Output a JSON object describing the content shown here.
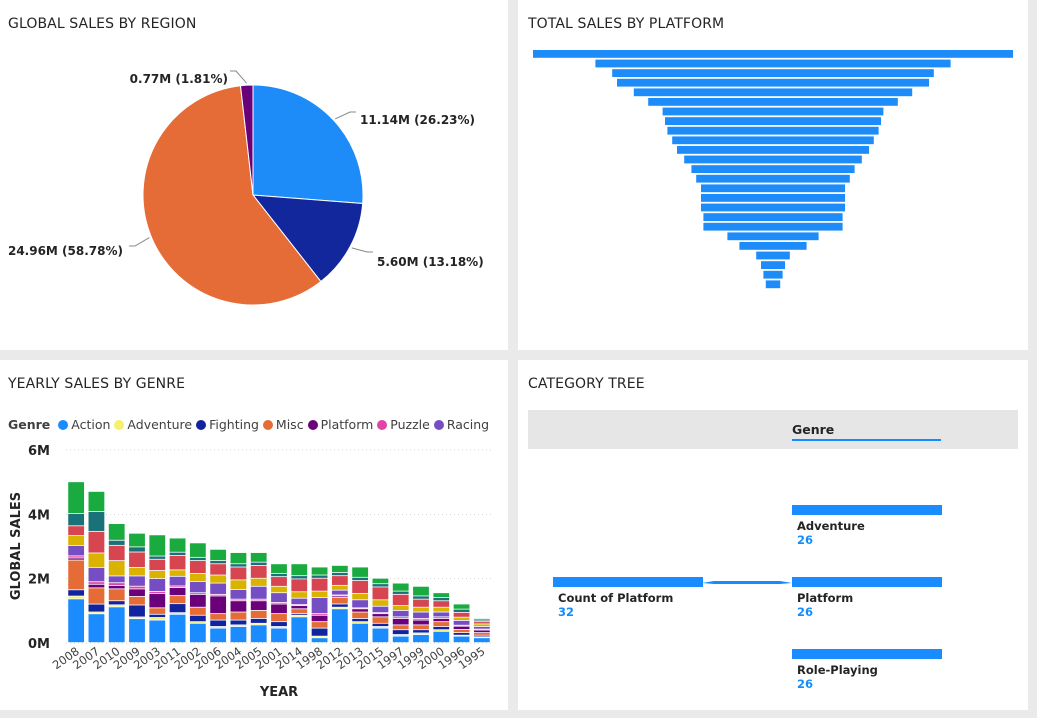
{
  "panels": {
    "region_title": "GLOBAL SALES BY REGION",
    "platform_title": "TOTAL SALES BY PLATFORM",
    "genre_title": "YEARLY SALES BY GENRE",
    "tree_title": "CATEGORY TREE"
  },
  "chart_data": [
    {
      "type": "pie",
      "title": "GLOBAL SALES BY REGION",
      "slices": [
        {
          "value": 11.14,
          "percent": 26.23,
          "label": "11.14M (26.23%)",
          "color": "#1e8cf8"
        },
        {
          "value": 5.6,
          "percent": 13.18,
          "label": "5.60M (13.18%)",
          "color": "#13279c"
        },
        {
          "value": 24.96,
          "percent": 58.78,
          "label": "24.96M (58.78%)",
          "color": "#e66c37"
        },
        {
          "value": 0.77,
          "percent": 1.81,
          "label": "0.77M (1.81%)",
          "color": "#6b007b"
        }
      ]
    },
    {
      "type": "bar",
      "title": "TOTAL SALES BY PLATFORM",
      "orientation": "funnel",
      "color": "#1e8cf8",
      "values": [
        100,
        74,
        67,
        65,
        58,
        52,
        46,
        45,
        44,
        42,
        40,
        37,
        34,
        32,
        30,
        30,
        30,
        29,
        29,
        19,
        14,
        7,
        5,
        4,
        3,
        1
      ]
    },
    {
      "type": "bar",
      "stacked": true,
      "title": "YEARLY SALES BY GENRE",
      "xlabel": "YEAR",
      "ylabel": "GLOBAL SALES",
      "ylim": [
        0,
        6000000
      ],
      "yticks": [
        "0M",
        "2M",
        "4M",
        "6M"
      ],
      "legend_title": "Genre",
      "legend": [
        {
          "name": "Action",
          "color": "#1a8cff"
        },
        {
          "name": "Adventure",
          "color": "#f5f06e"
        },
        {
          "name": "Fighting",
          "color": "#12239e"
        },
        {
          "name": "Misc",
          "color": "#e66c37"
        },
        {
          "name": "Platform",
          "color": "#6b007b"
        },
        {
          "name": "Puzzle",
          "color": "#e044a7"
        },
        {
          "name": "Racing",
          "color": "#744ec2"
        }
      ],
      "categories": [
        "2008",
        "2007",
        "2010",
        "2009",
        "2003",
        "2011",
        "2002",
        "2006",
        "2004",
        "2005",
        "2001",
        "2014",
        "1998",
        "2012",
        "2013",
        "2015",
        "1997",
        "1999",
        "2000",
        "1996",
        "1995"
      ],
      "totals": [
        5.0,
        4.7,
        3.7,
        3.4,
        3.35,
        3.25,
        3.1,
        2.9,
        2.8,
        2.8,
        2.45,
        2.45,
        2.35,
        2.4,
        2.35,
        2.0,
        1.85,
        1.75,
        1.55,
        1.2,
        0.75
      ],
      "segment_colors": [
        "#1a8cff",
        "#f5f06e",
        "#12239e",
        "#e66c37",
        "#6b007b",
        "#e044a7",
        "#744ec2",
        "#d9b300",
        "#d64550",
        "#197278",
        "#1aab40"
      ],
      "segments": [
        [
          1.25,
          0.08,
          0.18,
          0.85,
          0.06,
          0.06,
          0.3,
          0.28,
          0.28,
          0.35,
          0.91
        ],
        [
          0.8,
          0.05,
          0.22,
          0.45,
          0.1,
          0.07,
          0.4,
          0.4,
          0.6,
          0.55,
          0.56
        ],
        [
          1.05,
          0.06,
          0.12,
          0.35,
          0.1,
          0.08,
          0.2,
          0.45,
          0.45,
          0.15,
          0.49
        ],
        [
          0.7,
          0.05,
          0.35,
          0.25,
          0.22,
          0.08,
          0.3,
          0.25,
          0.45,
          0.15,
          0.4
        ],
        [
          0.7,
          0.08,
          0.1,
          0.2,
          0.45,
          0.06,
          0.4,
          0.25,
          0.35,
          0.1,
          0.66
        ],
        [
          0.88,
          0.05,
          0.28,
          0.25,
          0.25,
          0.05,
          0.3,
          0.2,
          0.45,
          0.1,
          0.44
        ],
        [
          0.6,
          0.05,
          0.2,
          0.25,
          0.4,
          0.05,
          0.35,
          0.25,
          0.4,
          0.1,
          0.45
        ],
        [
          0.45,
          0.05,
          0.2,
          0.2,
          0.55,
          0.05,
          0.35,
          0.25,
          0.35,
          0.1,
          0.35
        ],
        [
          0.5,
          0.05,
          0.15,
          0.25,
          0.35,
          0.05,
          0.3,
          0.3,
          0.4,
          0.1,
          0.35
        ],
        [
          0.55,
          0.05,
          0.15,
          0.25,
          0.3,
          0.05,
          0.4,
          0.25,
          0.4,
          0.1,
          0.3
        ],
        [
          0.45,
          0.05,
          0.15,
          0.25,
          0.3,
          0.05,
          0.3,
          0.2,
          0.3,
          0.1,
          0.3
        ],
        [
          0.8,
          0.05,
          0.05,
          0.15,
          0.1,
          0.03,
          0.2,
          0.2,
          0.4,
          0.1,
          0.37
        ],
        [
          0.15,
          0.05,
          0.25,
          0.2,
          0.2,
          0.05,
          0.5,
          0.2,
          0.4,
          0.1,
          0.25
        ],
        [
          1.05,
          0.05,
          0.1,
          0.2,
          0.05,
          0.03,
          0.15,
          0.15,
          0.3,
          0.1,
          0.22
        ],
        [
          0.6,
          0.05,
          0.1,
          0.2,
          0.1,
          0.03,
          0.25,
          0.2,
          0.4,
          0.1,
          0.32
        ],
        [
          0.45,
          0.05,
          0.1,
          0.2,
          0.1,
          0.03,
          0.2,
          0.2,
          0.4,
          0.1,
          0.17
        ],
        [
          0.2,
          0.05,
          0.15,
          0.15,
          0.2,
          0.05,
          0.2,
          0.15,
          0.35,
          0.1,
          0.25
        ],
        [
          0.25,
          0.05,
          0.1,
          0.15,
          0.15,
          0.05,
          0.2,
          0.15,
          0.25,
          0.1,
          0.3
        ],
        [
          0.35,
          0.05,
          0.1,
          0.15,
          0.1,
          0.05,
          0.15,
          0.15,
          0.2,
          0.1,
          0.15
        ],
        [
          0.2,
          0.03,
          0.08,
          0.1,
          0.1,
          0.03,
          0.15,
          0.1,
          0.15,
          0.1,
          0.16
        ],
        [
          0.15,
          0.03,
          0.05,
          0.08,
          0.08,
          0.03,
          0.08,
          0.08,
          0.07,
          0.05,
          0.05
        ]
      ]
    }
  ],
  "tree": {
    "header": "Genre",
    "root": {
      "label": "Count of Platform",
      "value": "32"
    },
    "children": [
      {
        "label": "Adventure",
        "value": "26"
      },
      {
        "label": "Platform",
        "value": "26"
      },
      {
        "label": "Role-Playing",
        "value": "26"
      }
    ]
  }
}
